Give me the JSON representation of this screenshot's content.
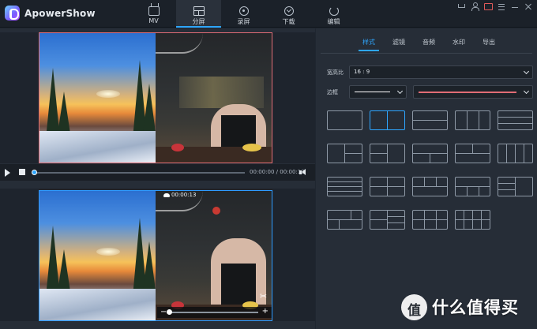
{
  "app": {
    "title": "ApowerShow"
  },
  "modes": [
    {
      "label": "MV",
      "icon": "tv-icon"
    },
    {
      "label": "分屏",
      "icon": "split-screen-icon",
      "active": true
    },
    {
      "label": "录屏",
      "icon": "record-icon"
    },
    {
      "label": "下载",
      "icon": "download-icon"
    },
    {
      "label": "编辑",
      "icon": "edit-icon"
    }
  ],
  "window_controls": [
    "cart-icon",
    "user-icon",
    "message-icon",
    "menu-icon",
    "minimize-icon",
    "close-icon"
  ],
  "player": {
    "time": "00:00:00 / 00:00:13",
    "progress": 0.0
  },
  "clip": {
    "time": "00:00:13"
  },
  "panel": {
    "tabs": [
      {
        "label": "样式",
        "active": true
      },
      {
        "label": "滤镜"
      },
      {
        "label": "音频"
      },
      {
        "label": "水印"
      },
      {
        "label": "导出"
      }
    ],
    "aspect_label": "宽高比",
    "aspect_value": "16 : 9",
    "border_label": "边框",
    "border_color": "#ffffff",
    "border_accent": "#e06c75"
  },
  "colors": {
    "accent": "#2ea6ff",
    "selected_frame_top": "#e06c75",
    "selected_frame_bottom": "#2e9bff"
  },
  "watermark": {
    "text": "什么值得买"
  }
}
